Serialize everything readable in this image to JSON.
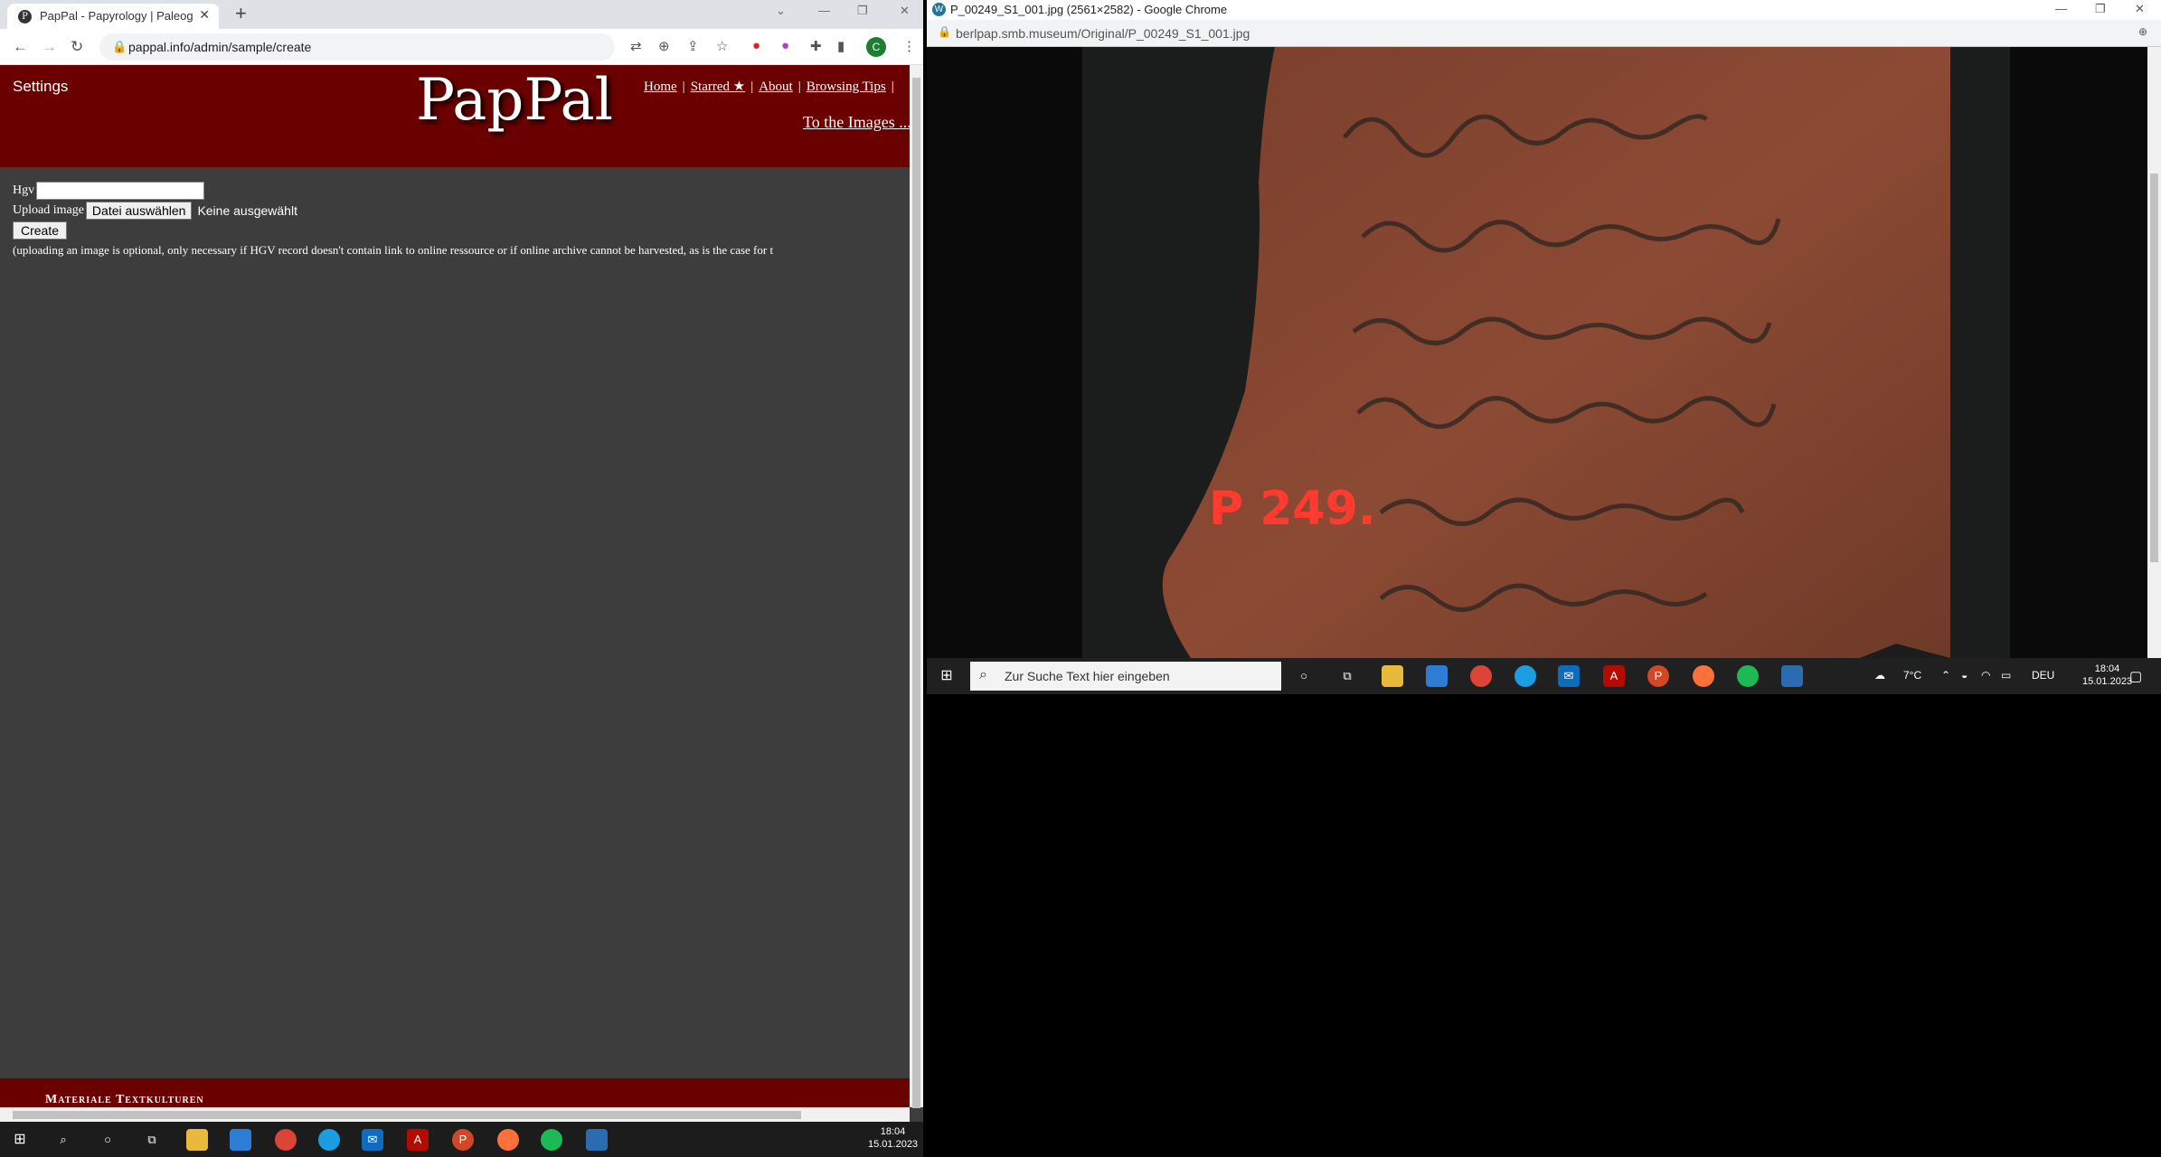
{
  "left_browser": {
    "tab_title": "PapPal - Papyrology | Paleograph",
    "url": "pappal.info/admin/sample/create",
    "profile_initial": "C",
    "site": {
      "settings_label": "Settings",
      "logo": "PapPal",
      "nav": [
        "Home",
        "Starred ★",
        "About",
        "Browsing Tips"
      ],
      "to_images": "To the Images ..."
    },
    "form": {
      "hgv_label": "Hgv",
      "upload_label": "Upload image",
      "choose_file_button": "Datei auswählen",
      "no_file_text": "Keine ausgewählt",
      "create_button": "Create",
      "note": "(uploading an image is optional, only necessary if HGV record doesn't contain link to online ressource or if online archive cannot be harvested, as is the case for t"
    },
    "footer_text": "Materiale Textkulturen"
  },
  "right_browser": {
    "window_title": "P_00249_S1_001.jpg (2561×2582) - Google Chrome",
    "url": "berlpap.smb.museum/Original/P_00249_S1_001.jpg",
    "photo_inventory_mark": "P 249."
  },
  "taskbar_right": {
    "search_placeholder": "Zur Suche Text hier eingeben",
    "weather": "7°C",
    "language": "DEU",
    "time": "18:04",
    "date": "15.01.2023"
  },
  "taskbar_bottom": {
    "time": "18:04",
    "date": "15.01.2023"
  },
  "colors": {
    "site_red": "#6b0000",
    "page_bg": "#3d3d3d",
    "taskbar": "#1c1c1c"
  }
}
